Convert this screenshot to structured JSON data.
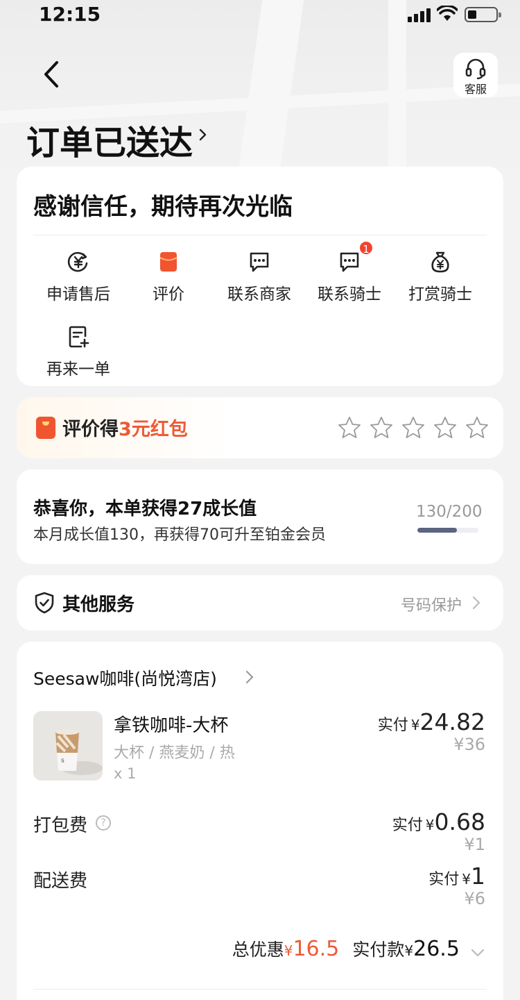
{
  "status_bar": {
    "time": "12:15"
  },
  "header": {
    "customer_service_label": "客服",
    "title": "订单已送达"
  },
  "summary": {
    "thanks_text": "感谢信任，期待再次光临",
    "actions": [
      {
        "label": "申请售后",
        "icon": "yen-refund-icon"
      },
      {
        "label": "评价",
        "icon": "red-envelope-icon"
      },
      {
        "label": "联系商家",
        "icon": "chat-bubble-icon"
      },
      {
        "label": "联系骑士",
        "icon": "chat-bubble-icon",
        "badge": "1"
      },
      {
        "label": "打赏骑士",
        "icon": "money-bag-icon"
      },
      {
        "label": "再来一单",
        "icon": "reorder-icon"
      }
    ]
  },
  "review": {
    "prefix": "评价得",
    "highlight": "3元红包",
    "stars": 5,
    "rating": 0,
    "highlight_color": "#ee5a36"
  },
  "growth": {
    "title": "恭喜你，本单获得27成长值",
    "subtitle": "本月成长值130，再获得70可升至铂金会员",
    "score_text": "130/200",
    "progress": 0.65
  },
  "service": {
    "title": "其他服务",
    "right_text": "号码保护"
  },
  "order": {
    "shop_name": "Seesaw咖啡(尚悦湾店)",
    "product": {
      "name": "拿铁咖啡-大杯",
      "spec": "大杯 / 燕麦奶 / 热",
      "qty": "x 1",
      "paid_label": "实付",
      "currency": "¥",
      "paid": "24.82",
      "original": "¥36"
    },
    "packing_fee": {
      "label": "打包费",
      "help_icon": "question-circle-icon",
      "paid_label": "实付",
      "currency": "¥",
      "paid": "0.68",
      "original": "¥1"
    },
    "delivery_fee": {
      "label": "配送费",
      "paid_label": "实付",
      "currency": "¥",
      "paid": "1",
      "original": "¥6"
    },
    "total": {
      "discount_label": "总优惠",
      "currency": "¥",
      "discount": "16.5",
      "paid_label": "实付款",
      "paid": "26.5"
    }
  }
}
